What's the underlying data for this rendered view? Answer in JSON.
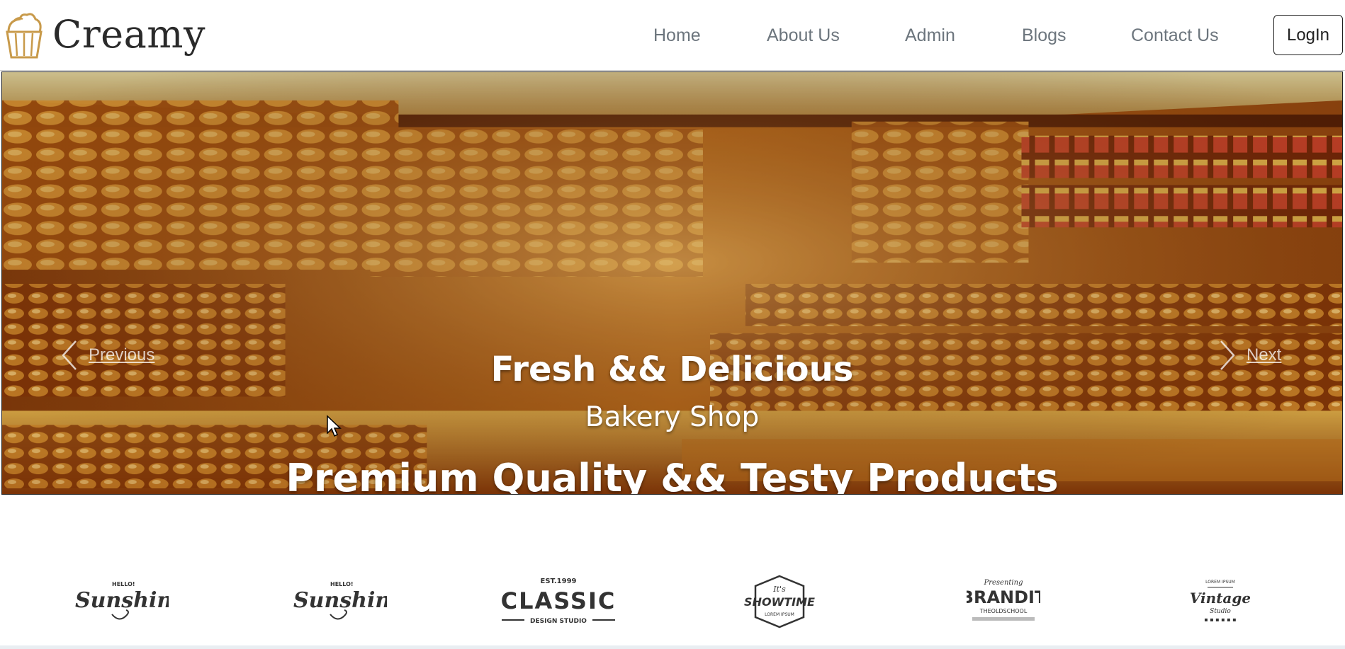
{
  "brand": {
    "name": "Creamy",
    "logo_icon": "cupcake-icon"
  },
  "nav": {
    "items": [
      {
        "label": "Home"
      },
      {
        "label": "About Us"
      },
      {
        "label": "Admin"
      },
      {
        "label": "Blogs"
      },
      {
        "label": "Contact Us"
      }
    ],
    "login_label": "LogIn"
  },
  "hero": {
    "prev_label": "Previous",
    "next_label": "Next",
    "caption_line1": "Fresh && Delicious",
    "caption_line2": "Bakery Shop",
    "caption_line3": "Premium Quality && Testy Products"
  },
  "brand_logos": [
    {
      "name": "sunshine-logo",
      "top": "HELLO!",
      "text": "Sunshine"
    },
    {
      "name": "sunshine-logo-2",
      "top": "HELLO!",
      "text": "Sunshine"
    },
    {
      "name": "classic-logo",
      "top": "EST.1999",
      "text": "CLASSIC",
      "sub": "DESIGN STUDIO"
    },
    {
      "name": "showtime-logo",
      "top": "It's",
      "text": "SHOWTIME",
      "sub": "LOREM IPSUM"
    },
    {
      "name": "brandit-logo",
      "top": "Presenting",
      "text": "BRANDIT",
      "sub": "THEOLDSCHOOL"
    },
    {
      "name": "vintage-logo",
      "top": "LOREM IPSUM",
      "text": "Vintage",
      "sub": "Studio"
    }
  ],
  "colors": {
    "nav_text": "#6c757d",
    "accent": "#c89a4a",
    "caption": "#ffffff"
  }
}
